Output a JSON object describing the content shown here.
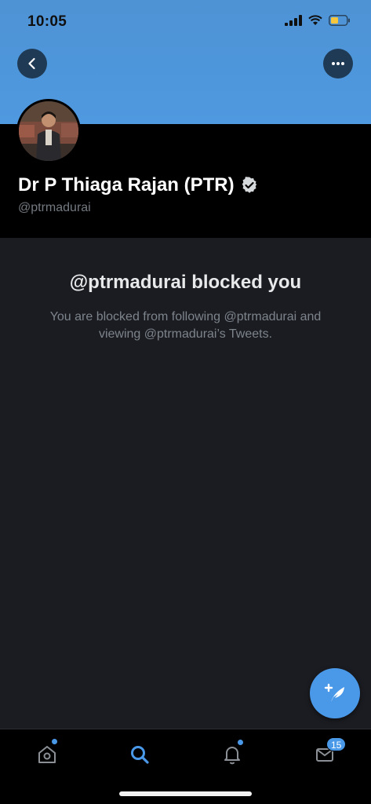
{
  "status_bar": {
    "time": "10:05"
  },
  "profile": {
    "display_name": "Dr P Thiaga Rajan (PTR)",
    "handle": "@ptrmadurai",
    "verified": true
  },
  "blocked": {
    "title": "@ptrmadurai blocked you",
    "message": "You are blocked from following @ptrmadurai and viewing @ptrmadurai’s Tweets."
  },
  "tab_bar": {
    "tabs": [
      {
        "name": "home",
        "icon": "home-icon",
        "has_dot": true
      },
      {
        "name": "search",
        "icon": "search-icon",
        "active": true
      },
      {
        "name": "notifications",
        "icon": "bell-icon",
        "has_dot": true
      },
      {
        "name": "messages",
        "icon": "envelope-icon",
        "badge": "15"
      }
    ]
  },
  "colors": {
    "accent": "#4a99e9",
    "banner": "#4f99e0",
    "background": "#1b1c21"
  }
}
